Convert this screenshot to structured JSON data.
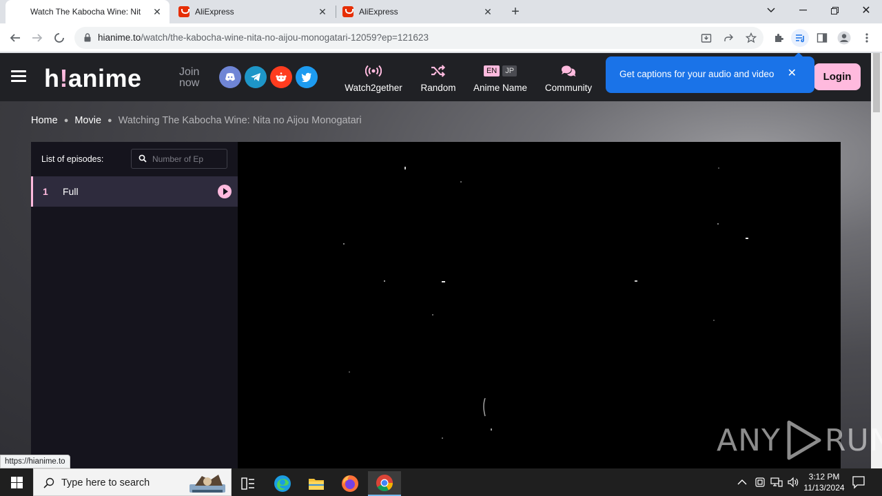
{
  "browser": {
    "tabs": [
      {
        "title": "Watch The Kabocha Wine: Nita no Aijou Monogatari",
        "active": true
      },
      {
        "title": "AliExpress",
        "active": false
      },
      {
        "title": "AliExpress",
        "active": false
      }
    ],
    "url_host": "hianime.to",
    "url_path": "/watch/the-kabocha-wine-nita-no-aijou-monogatari-12059?ep=121623",
    "status_url": "https://hianime.to"
  },
  "site": {
    "logo_h": "h",
    "logo_bang": "!",
    "logo_rest": "anime",
    "join_line1": "Join",
    "join_line2": "now",
    "social": [
      {
        "name": "discord",
        "color": "#6f85d5"
      },
      {
        "name": "telegram",
        "color": "#1e96c8"
      },
      {
        "name": "reddit",
        "color": "#ff3c1f"
      },
      {
        "name": "twitter",
        "color": "#1d9bf0"
      }
    ],
    "nav": {
      "watch2gether": "Watch2gether",
      "random": "Random",
      "anime_name": "Anime Name",
      "lang_en": "EN",
      "lang_jp": "JP",
      "community": "Community"
    },
    "login": "Login",
    "accent": "#ffbade"
  },
  "caption_tooltip": {
    "text": "Get captions for your audio and video",
    "close": "✕"
  },
  "breadcrumb": {
    "home": "Home",
    "movie": "Movie",
    "current": "Watching The Kabocha Wine: Nita no Aijou Monogatari"
  },
  "episodes": {
    "title": "List of episodes:",
    "search_placeholder": "Number of Ep",
    "items": [
      {
        "number": "1",
        "name": "Full"
      }
    ]
  },
  "watermark": {
    "left": "ANY",
    "right": "RUN"
  },
  "taskbar": {
    "search_text": "Type here to search",
    "time": "3:12 PM",
    "date": "11/13/2024"
  }
}
